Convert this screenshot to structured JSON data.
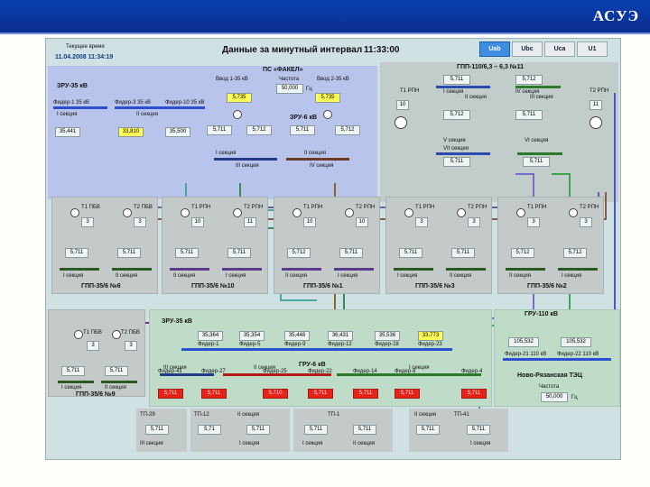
{
  "header": {
    "title": "АСУЭ"
  },
  "top": {
    "time_label": "Текущее время",
    "datetime": "11.04.2008  11:34:19",
    "interval_title": "Данные за минутный интервал",
    "interval_time": "11:33:00",
    "tabs": [
      "Uab",
      "Ubc",
      "Uca",
      "U1"
    ]
  },
  "fakel": {
    "title": "ПС «ФАКЕЛ»",
    "vvod1": "Ввод 1-35 кВ",
    "freq_label": "Частота",
    "vvod2": "Ввод 2-35 кВ",
    "v1": "5,735",
    "freq": "50,000",
    "hz": "Гц",
    "v2": "5,735",
    "unit_kv": "кВ"
  },
  "zru35": {
    "title": "ЗРУ-35 кВ",
    "f1": "Фидер-1 35 кВ",
    "f2": "Фидер-3 35 кВ",
    "f3": "Фидер-10 35 кВ",
    "s1": "I секция",
    "s2": "II секция",
    "v1": "35,441",
    "v2": "33,810",
    "v3": "35,500"
  },
  "zru6": {
    "title": "ЗРУ-6 кВ",
    "v1": "5,711",
    "v2": "5,712",
    "v3": "5,711",
    "v4": "5,712",
    "s1": "I секция",
    "s2": "II секция",
    "s3": "III секция",
    "s4": "IV секция"
  },
  "gpp110": {
    "title": "ГПП-110/6,3 – 6,3 №11",
    "t1": "Т1 РПН",
    "t2": "Т2 РПН",
    "t1v": "10",
    "t2v": "11",
    "vals": [
      "5,711",
      "5,712",
      "5,712",
      "5,711",
      "5,711",
      "5,711"
    ],
    "s1": "I секция",
    "s2": "II секция",
    "s3": "III секция",
    "s4": "IV секция",
    "s5": "V секция",
    "s6": "VI секция",
    "s7": "VII секция"
  },
  "subs": [
    {
      "title": "ГПП-35/6 №6",
      "ta": "Т1 ПБВ",
      "tb": "Т2 ПБВ",
      "na": "3",
      "nb": "3",
      "va": "5,711",
      "vb": "5,711",
      "sa": "I секция",
      "sb": "II секция",
      "col": "#2a5a22"
    },
    {
      "title": "ГПП-35/6 №10",
      "ta": "Т1 РПН",
      "tb": "Т2 РПН",
      "na": "10",
      "nb": "11",
      "va": "5,711",
      "vb": "5,711",
      "sa": "II секция",
      "sb": "I секция",
      "col": "#5b3b8a"
    },
    {
      "title": "ГПП-35/6 №1",
      "ta": "Т1 РПН",
      "tb": "Т2 РПН",
      "na": "10",
      "nb": "10",
      "va": "5,712",
      "vb": "5,711",
      "sa": "II секция",
      "sb": "I секция",
      "col": "#5b3b8a"
    },
    {
      "title": "ГПП-35/6 №3",
      "ta": "Т1 РПН",
      "tb": "Т2 РПН",
      "na": "3",
      "nb": "3",
      "va": "5,711",
      "vb": "5,711",
      "sa": "I секция",
      "sb": "II секция",
      "col": "#2a5a22"
    },
    {
      "title": "ГПП-35/6 №2",
      "ta": "Т1 РПН",
      "tb": "Т2 РПН",
      "na": "3",
      "nb": "3",
      "va": "5,712",
      "vb": "5,712",
      "sa": "II секция",
      "sb": "I секция",
      "col": "#2a5a22"
    }
  ],
  "gpp9": {
    "title": "ГПП-35/6 №9",
    "ta": "Т1 ПБВ",
    "tb": "Т2 ПБВ",
    "na": "3",
    "nb": "3",
    "va": "5,711",
    "vb": "5,711",
    "sa": "I секция",
    "sb": "II секция"
  },
  "tec": {
    "zru35": "ЗРУ-35 кВ",
    "v": [
      "35,364",
      "35,354",
      "35,448",
      "36,431",
      "35,536",
      "33,773"
    ],
    "fid": [
      "Фидер-1",
      "Фидер-5",
      "Фидер-9",
      "Фидер-12",
      "Фидер-18",
      "Фидер-23"
    ],
    "gru110": "ГРУ-110 кВ",
    "v110a": "105,532",
    "v110b": "105,532",
    "f21": "Фидер-21 110 кВ",
    "f22": "Фидер-22 110 кВ",
    "gru6": "ГРУ-6 кВ",
    "red": [
      "5,711",
      "5,711",
      "5,710",
      "5,711",
      "5,711",
      "5,711",
      "5,711"
    ],
    "fid6": [
      "Фидер-41",
      "Фидер-27",
      "Фидер-25",
      "Фидер-22",
      "Фидер-14",
      "Фидер-8",
      "Фидер-4"
    ],
    "sec": [
      "III секция",
      "II секция",
      "I секция"
    ],
    "name": "Ново-Рязанская ТЭЦ",
    "freq_label": "Частота",
    "freq": "50,000",
    "hz": "Гц"
  },
  "tp": [
    {
      "title": "ТП-29",
      "v": "5,711",
      "s": "III секция"
    },
    {
      "title": "ТП-12",
      "va": "5,71",
      "vb": "5,711",
      "sa": "II секция",
      "sb": "I секция"
    },
    {
      "title": "ТП-1",
      "va": "5,711",
      "vb": "5,711",
      "sa": "I секция",
      "sb": "II секция"
    },
    {
      "title": "ТП-41",
      "va": "5,711",
      "vb": "5,711",
      "sa": "II секция",
      "sb": "I секция"
    }
  ]
}
